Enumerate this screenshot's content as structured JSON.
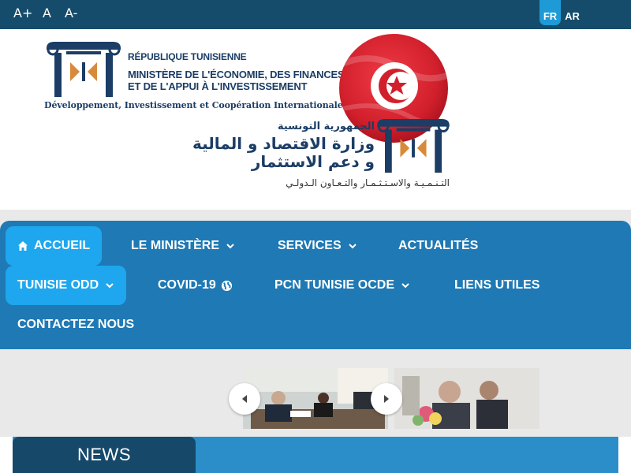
{
  "topbar": {
    "font_increase": "A+",
    "font_normal": "A",
    "font_decrease": "A-",
    "languages": [
      {
        "code": "FR",
        "active": true
      },
      {
        "code": "AR",
        "active": false
      }
    ]
  },
  "header": {
    "fr_republic": "RÉPUBLIQUE TUNISIENNE",
    "fr_ministry_line1": "MINISTÈRE DE L'ÉCONOMIE, DES FINANCES",
    "fr_ministry_line2": "ET DE L'APPUI À L'INVESTISSEMENT",
    "fr_tagline": "Développement, Investissement et Coopération Internationale",
    "ar_republic": "الجمهورية التونسية",
    "ar_ministry_line1": "وزارة الاقتصاد و المالية",
    "ar_ministry_line2": "و دعم الاستثمار",
    "ar_tagline": "التـنـمـيـة والاسـتـثـمـار والتـعـاون الـدولـي"
  },
  "nav": {
    "items": [
      {
        "label": "ACCUEIL",
        "icon": "home-icon",
        "active": true
      },
      {
        "label": "LE MINISTÈRE",
        "dropdown": true
      },
      {
        "label": "SERVICES",
        "dropdown": true
      },
      {
        "label": "ACTUALITÉS"
      },
      {
        "label": "TUNISIE ODD",
        "dropdown": true,
        "active": true
      },
      {
        "label": "COVID-19",
        "icon": "globe-icon"
      },
      {
        "label": "PCN TUNISIE OCDE",
        "dropdown": true
      },
      {
        "label": "LIENS UTILES"
      },
      {
        "label": "CONTACTEZ NOUS"
      }
    ]
  },
  "news": {
    "title": "NEWS"
  },
  "colors": {
    "topbar": "#164c6b",
    "nav": "#1f79b4",
    "nav_active": "#1ea7ee",
    "news_tab": "#16486a",
    "news_bar": "#2b8ec8"
  }
}
